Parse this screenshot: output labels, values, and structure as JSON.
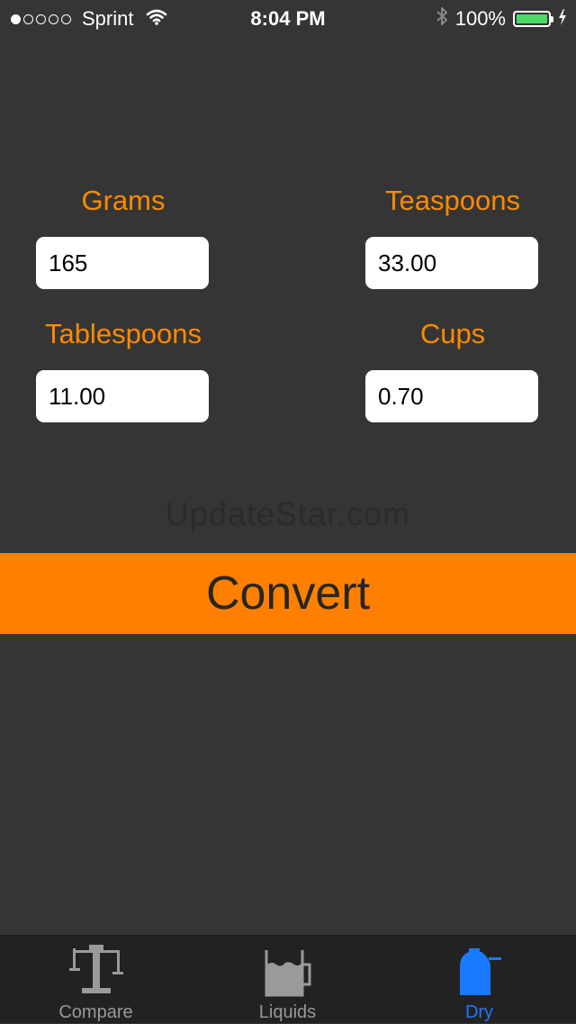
{
  "status_bar": {
    "carrier": "Sprint",
    "time": "8:04 PM",
    "battery_percent": "100%",
    "signal_bars_filled": 1,
    "signal_bars_total": 5
  },
  "fields": {
    "grams": {
      "label": "Grams",
      "value": "165"
    },
    "teaspoons": {
      "label": "Teaspoons",
      "value": "33.00"
    },
    "tablespoons": {
      "label": "Tablespoons",
      "value": "11.00"
    },
    "cups": {
      "label": "Cups",
      "value": "0.70"
    }
  },
  "watermark": "UpdateStar.com",
  "convert_label": "Convert",
  "tabs": [
    {
      "label": "Compare",
      "icon": "balance-scale-icon",
      "active": false
    },
    {
      "label": "Liquids",
      "icon": "liquid-container-icon",
      "active": false
    },
    {
      "label": "Dry",
      "icon": "dry-container-icon",
      "active": true
    }
  ],
  "colors": {
    "background": "#353535",
    "accent_orange": "#ff8000",
    "label_orange": "#ff8a00",
    "tab_active": "#1a7aff",
    "tab_inactive": "#999999",
    "battery_green": "#4cd964"
  }
}
